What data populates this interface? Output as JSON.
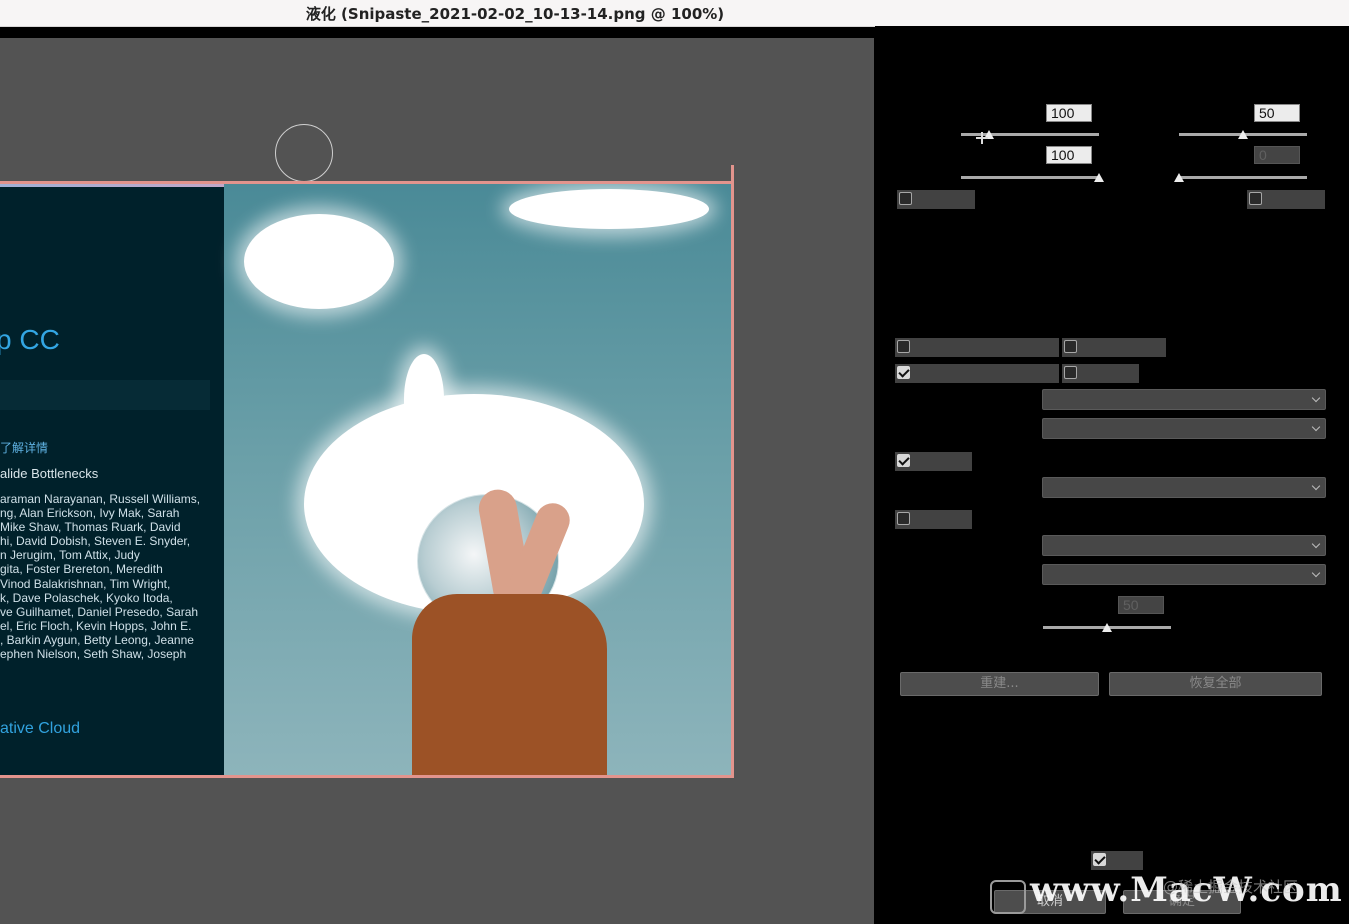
{
  "window": {
    "title": "液化 (Snipaste_2021-02-02_10-13-14.png @ 100%)"
  },
  "splash": {
    "app_name": "p CC",
    "learn_more": "了解详情",
    "subtitle": "alide Bottlenecks",
    "credits": [
      "araman Narayanan, Russell Williams,",
      "ng, Alan Erickson, Ivy Mak, Sarah",
      "Mike Shaw, Thomas Ruark, David",
      "hi, David Dobish, Steven E. Snyder,",
      "n Jerugim, Tom Attix, Judy",
      "gita, Foster Brereton, Meredith",
      "Vinod Balakrishnan, Tim Wright,",
      "k, Dave Polaschek, Kyoko Itoda,",
      "ve Guilhamet, Daniel Presedo, Sarah",
      "el, Eric Floch, Kevin Hopps, John E.",
      ", Barkin Aygun, Betty Leong, Jeanne",
      "ephen Nielson, Seth Shaw, Joseph"
    ],
    "footer": "ative Cloud"
  },
  "panel": {
    "fields": {
      "brush_size": "100",
      "brush_pressure": "100",
      "brush_density": "50",
      "brush_rate": "0",
      "mask_amount": "50"
    },
    "sliders": {
      "brush_size": 0.2,
      "brush_pressure": 1.0,
      "brush_density": 0.5,
      "brush_rate": 0.0,
      "mask_amount": 0.5
    },
    "checkboxes": {
      "pressure": false,
      "pin_edges": false,
      "show_image": false,
      "show_mask": false,
      "show_mesh": true,
      "show_backdrop": false,
      "view_option": true,
      "restore_option": false,
      "preview": true
    },
    "buttons": {
      "rebuild": "重建...",
      "restore_all": "恢复全部",
      "cancel": "取消",
      "ok": "确定"
    }
  },
  "watermark": {
    "site": "www.MacW.com",
    "community": "@稀土掘金技术社区"
  }
}
